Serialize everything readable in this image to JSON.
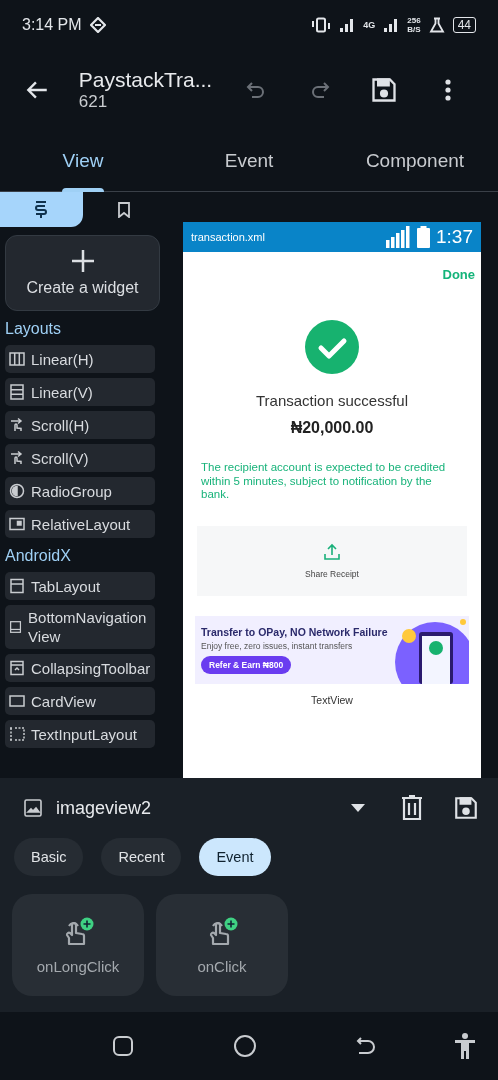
{
  "status_bar": {
    "time": "3:14 PM",
    "network": "4G",
    "speed": "256",
    "speed_unit": "B/S",
    "battery": "44"
  },
  "app_bar": {
    "title": "PaystackTra...",
    "subtitle": "621"
  },
  "tabs": [
    {
      "label": "View",
      "selected": true
    },
    {
      "label": "Event",
      "selected": false
    },
    {
      "label": "Component",
      "selected": false
    }
  ],
  "sidebar": {
    "tabs": [
      {
        "kind": "widgets",
        "selected": true
      },
      {
        "kind": "bookmarks",
        "selected": false
      }
    ],
    "create_widget": "Create a widget",
    "sections": [
      {
        "title": "Layouts",
        "items": [
          {
            "label": "Linear(H)",
            "kind": "columns"
          },
          {
            "label": "Linear(V)",
            "kind": "rows"
          },
          {
            "label": "Scroll(H)",
            "kind": "swipe"
          },
          {
            "label": "Scroll(V)",
            "kind": "swipe"
          },
          {
            "label": "RadioGroup",
            "kind": "radio"
          },
          {
            "label": "RelativeLayout",
            "kind": "frame"
          }
        ]
      },
      {
        "title": "AndroidX",
        "items": [
          {
            "label": "TabLayout",
            "kind": "tabs"
          },
          {
            "label": "BottomNavigationView",
            "kind": "bottom"
          },
          {
            "label": "CollapsingToolbar",
            "kind": "collapse"
          },
          {
            "label": "CardView",
            "kind": "card"
          },
          {
            "label": "TextInputLayout",
            "kind": "input"
          }
        ]
      }
    ]
  },
  "preview": {
    "file_name": "transaction.xml",
    "time": "1:37",
    "done": "Done",
    "status": "Transaction successful",
    "amount": "₦20,000.00",
    "note": "The recipient account is expected to be credited within 5 minutes, subject to notification by the bank.",
    "share": "Share Receipt",
    "banner": {
      "title": "Transfer to OPay, NO Network Failure",
      "subtitle": "Enjoy free, zero issues, instant transfers",
      "button": "Refer & Earn ₦800"
    },
    "textview": "TextView"
  },
  "properties": {
    "widget": "imageview2",
    "chips": [
      {
        "label": "Basic",
        "selected": false
      },
      {
        "label": "Recent",
        "selected": false
      },
      {
        "label": "Event",
        "selected": true
      }
    ],
    "events": [
      {
        "label": "onLongClick"
      },
      {
        "label": "onClick"
      }
    ]
  }
}
